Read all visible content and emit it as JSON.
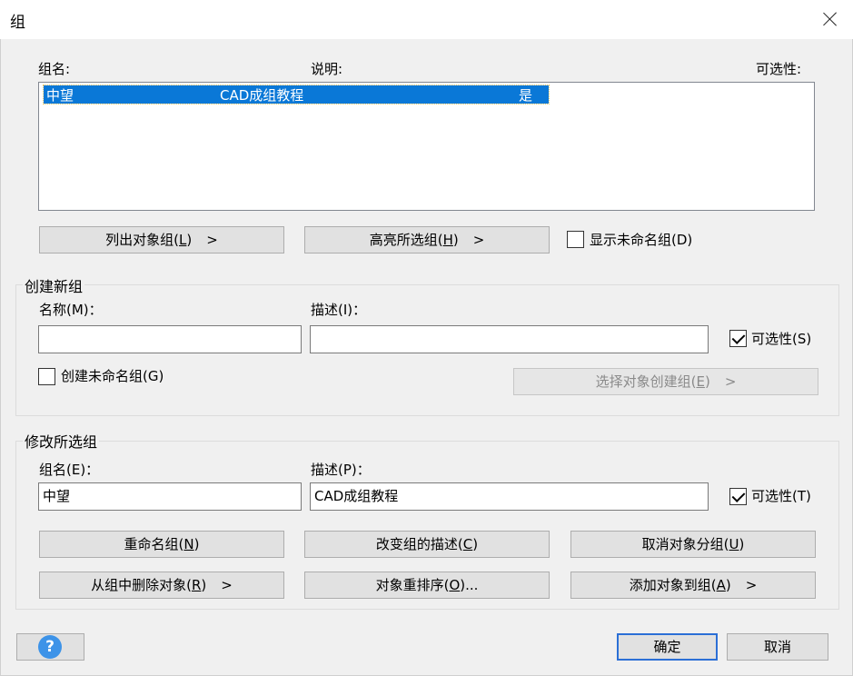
{
  "window": {
    "title": "组"
  },
  "group_list": {
    "col_name": "组名:",
    "col_desc": "说明:",
    "col_selectable": "可选性:",
    "rows": [
      {
        "name": "中望",
        "desc": "CAD成组教程",
        "selectable": "是"
      }
    ]
  },
  "top_buttons": {
    "list_pre": "列出对象组(",
    "list_key": "L",
    "list_post": ")",
    "list_arrow": ">",
    "highlight_pre": "高亮所选组(",
    "highlight_key": "H",
    "highlight_post": ")",
    "highlight_arrow": ">",
    "show_unnamed": "显示未命名组(D)"
  },
  "create": {
    "title": "创建新组",
    "name_label": "名称(M)：",
    "desc_label": "描述(I)：",
    "name_value": "",
    "desc_value": "",
    "selectable_label": "可选性(S)",
    "unnamed_label": "创建未命名组(G)",
    "select_btn_pre": "选择对象创建组(",
    "select_btn_key": "E",
    "select_btn_post": ")",
    "select_btn_arrow": ">"
  },
  "modify": {
    "title": "修改所选组",
    "name_label": "组名(E)：",
    "desc_label": "描述(P)：",
    "name_value": "中望",
    "desc_value": "CAD成组教程",
    "selectable_label": "可选性(T)",
    "rename_pre": "重命名组(",
    "rename_key": "N",
    "rename_post": ")",
    "change_desc_pre": "改变组的描述(",
    "change_desc_key": "C",
    "change_desc_post": ")",
    "ungroup_pre": "取消对象分组(",
    "ungroup_key": "U",
    "ungroup_post": ")",
    "remove_pre": "从组中删除对象(",
    "remove_key": "R",
    "remove_post": ")",
    "remove_arrow": ">",
    "reorder_pre": "对象重排序(",
    "reorder_key": "O",
    "reorder_post": ")...",
    "add_pre": "添加对象到组(",
    "add_key": "A",
    "add_post": ")",
    "add_arrow": ">"
  },
  "footer": {
    "help_icon": "?",
    "ok": "确定",
    "cancel": "取消"
  }
}
